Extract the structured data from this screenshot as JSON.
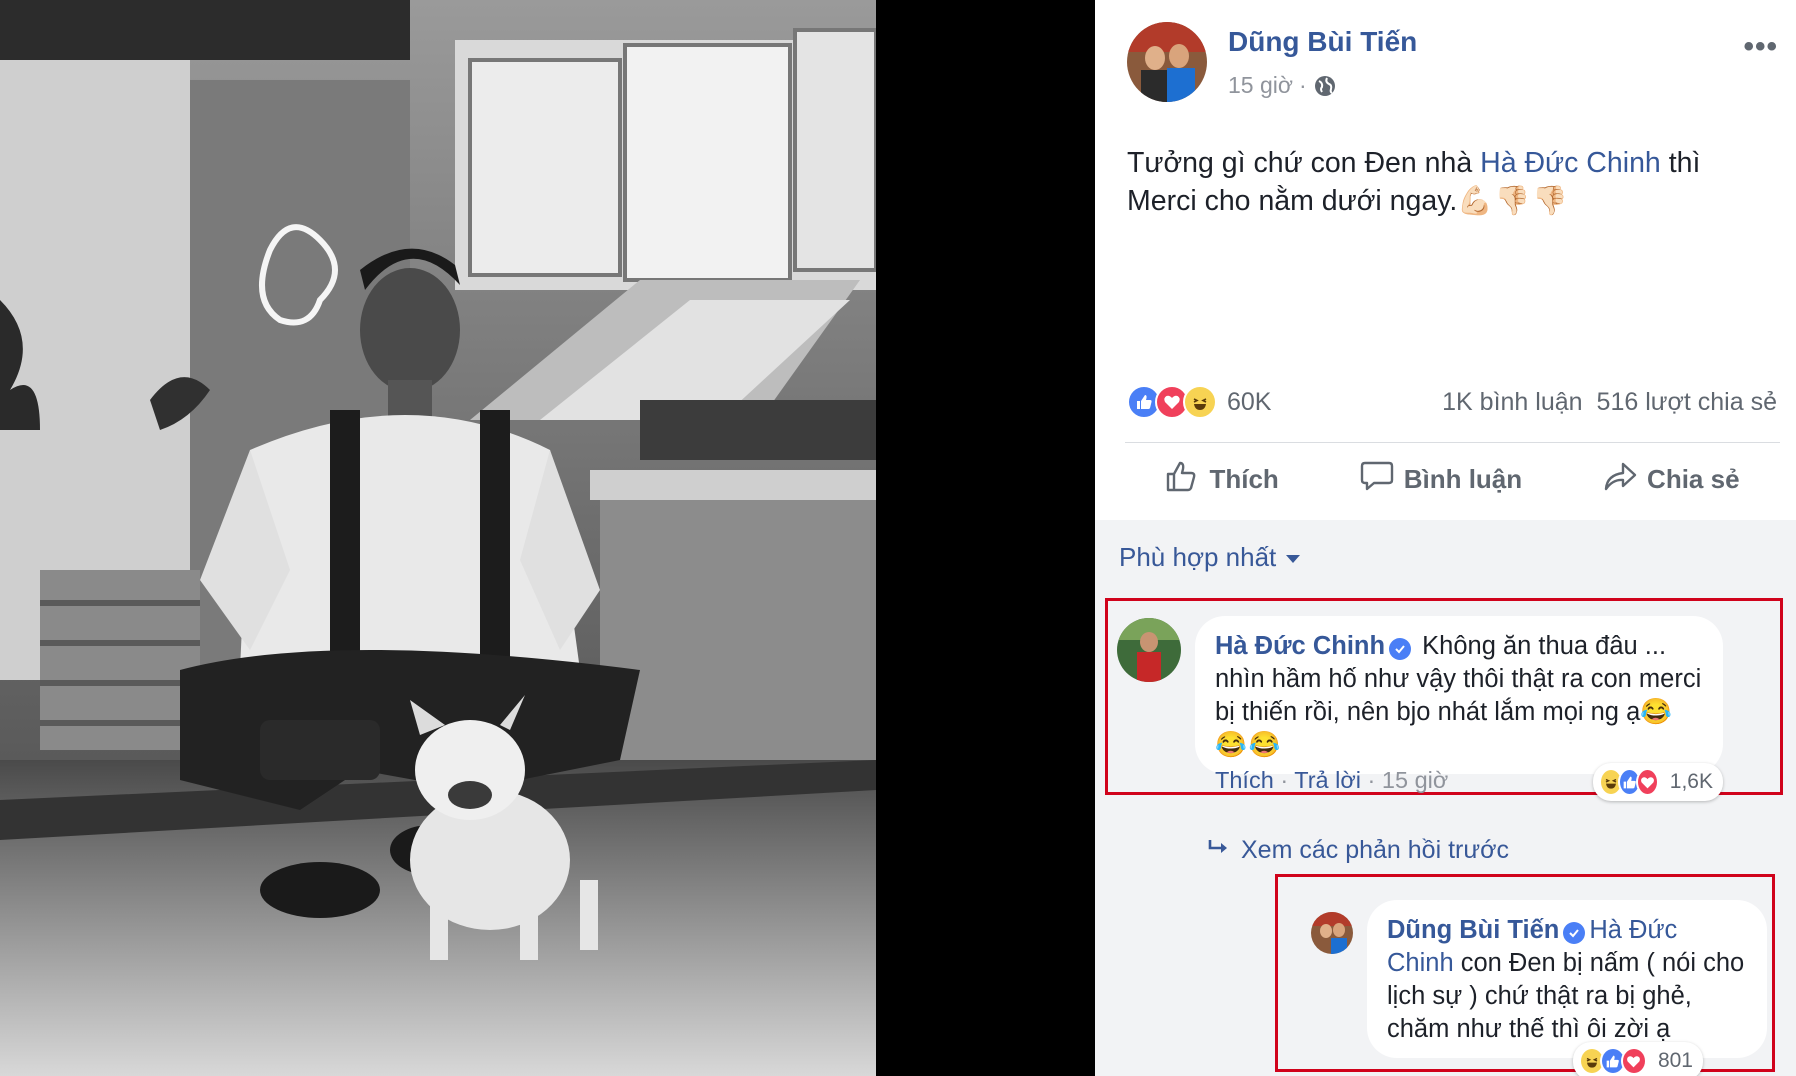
{
  "post": {
    "author": "Dũng Bùi Tiến",
    "time": "15 giờ",
    "separator": "·",
    "privacy_icon": "globe-icon",
    "more_label": "•••",
    "text_before": "Tưởng gì chứ con Đen nhà ",
    "mention": "Hà Đức Chinh",
    "text_after": " thì Merci cho nằm dưới ngay.",
    "text_emojis": "💪🏻👎🏻👎🏻"
  },
  "stats": {
    "reactions": [
      "like",
      "love",
      "haha"
    ],
    "reaction_count": "60K",
    "comments": "1K bình luận",
    "shares": "516 lượt chia sẻ"
  },
  "actions": {
    "like": "Thích",
    "comment": "Bình luận",
    "share": "Chia sẻ"
  },
  "comments": {
    "sort_label": "Phù hợp nhất",
    "first": {
      "author": "Hà Đức Chinh",
      "text": "Không ăn thua đâu ... nhìn hầm hố như vậy thôi thật ra con merci bị thiến rồi, nên bjo nhát lắm mọi ng ạ",
      "emojis_inline": "😂",
      "emojis_line": "😂😂",
      "like_link": "Thích",
      "reply_link": "Trả lời",
      "dot": "·",
      "time": "15 giờ",
      "reaction_count": "1,6K"
    },
    "view_previous": "Xem các phản hồi trước",
    "reply": {
      "author": "Dũng Bùi Tiến",
      "mention": "Hà Đức Chinh",
      "text": "con Đen bị nấm ( nói cho lịch sự ) chứ thật ra bị ghẻ, chăm như thế thì ôi zời ạ",
      "reaction_count": "801"
    }
  },
  "colors": {
    "link_blue": "#365899",
    "highlight_red": "#d0021b",
    "like_blue": "#4a7ff6",
    "love_red": "#f0405b",
    "haha_yellow": "#f7d353"
  }
}
